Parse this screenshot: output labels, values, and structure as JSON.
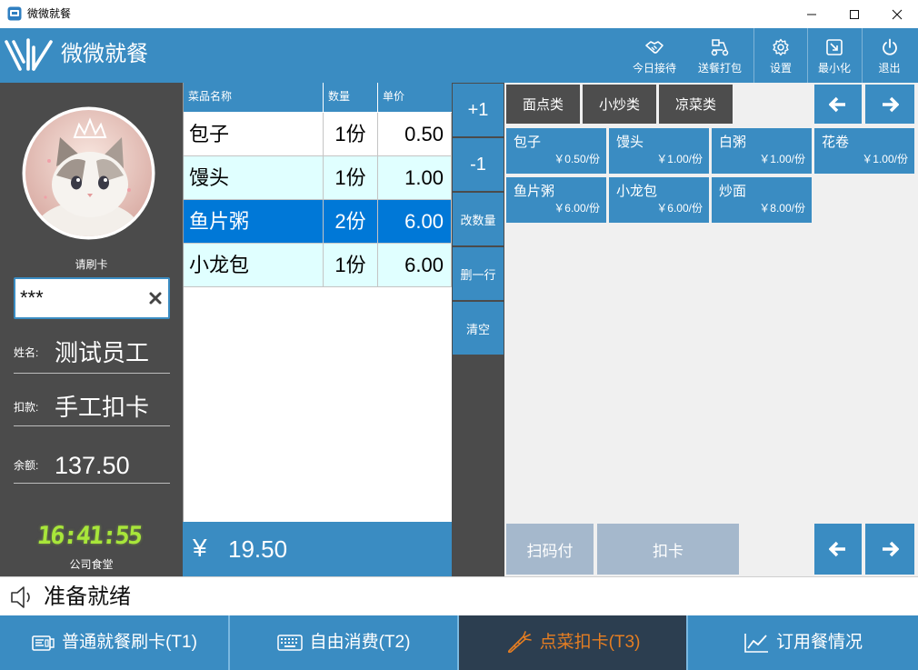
{
  "window": {
    "title": "微微就餐"
  },
  "header": {
    "brand": "微微就餐",
    "actions": [
      {
        "label": "今日接待",
        "icon": "handshake-icon"
      },
      {
        "label": "送餐打包",
        "icon": "delivery-icon"
      },
      {
        "label": "设置",
        "icon": "gear-icon"
      },
      {
        "label": "最小化",
        "icon": "minimize-icon"
      },
      {
        "label": "退出",
        "icon": "power-icon"
      }
    ]
  },
  "user": {
    "prompt": "请刷卡",
    "card_input": "***",
    "name_label": "姓名:",
    "name": "测试员工",
    "deduct_label": "扣款:",
    "deduct": "手工扣卡",
    "balance_label": "余额:",
    "balance": "137.50",
    "clock": "16:41:55",
    "location": "公司食堂"
  },
  "order": {
    "columns": [
      "菜品名称",
      "数量",
      "单价"
    ],
    "rows": [
      {
        "name": "包子",
        "qty": "1份",
        "price": "0.50",
        "selected": false
      },
      {
        "name": "馒头",
        "qty": "1份",
        "price": "1.00",
        "selected": false
      },
      {
        "name": "鱼片粥",
        "qty": "2份",
        "price": "6.00",
        "selected": true
      },
      {
        "name": "小龙包",
        "qty": "1份",
        "price": "6.00",
        "selected": false
      }
    ],
    "total_symbol": "¥",
    "total": "19.50"
  },
  "actions": [
    "+1",
    "-1",
    "改数量",
    "删一行",
    "清空"
  ],
  "menu": {
    "categories": [
      "面点类",
      "小炒类",
      "凉菜类"
    ],
    "dishes": [
      {
        "name": "包子",
        "price": "￥0.50/份"
      },
      {
        "name": "馒头",
        "price": "￥1.00/份"
      },
      {
        "name": "白粥",
        "price": "￥1.00/份"
      },
      {
        "name": "花卷",
        "price": "￥1.00/份"
      },
      {
        "name": "鱼片粥",
        "price": "￥6.00/份"
      },
      {
        "name": "小龙包",
        "price": "￥6.00/份"
      },
      {
        "name": "炒面",
        "price": "￥8.00/份"
      }
    ],
    "pay_buttons": [
      "扫码付",
      "扣卡"
    ]
  },
  "status": {
    "text": "准备就绪",
    "icon": "speaker-icon"
  },
  "tabs": [
    {
      "label": "普通就餐刷卡(T1)",
      "icon": "card-reader-icon",
      "active": false
    },
    {
      "label": "自由消费(T2)",
      "icon": "keyboard-icon",
      "active": false
    },
    {
      "label": "点菜扣卡(T3)",
      "icon": "carrot-icon",
      "active": true
    },
    {
      "label": "订用餐情况",
      "icon": "chart-icon",
      "active": false
    }
  ],
  "colors": {
    "primary": "#3a8cc2",
    "dark_panel": "#4b4b4b",
    "selected_row": "#0078d7",
    "alt_row": "#e0ffff",
    "active_tab": "#2c3e50",
    "active_tab_text": "#e67e22",
    "pay_button": "#a5b8cc",
    "clock": "#a8e63a",
    "menu_bg": "#f0f0f0"
  }
}
